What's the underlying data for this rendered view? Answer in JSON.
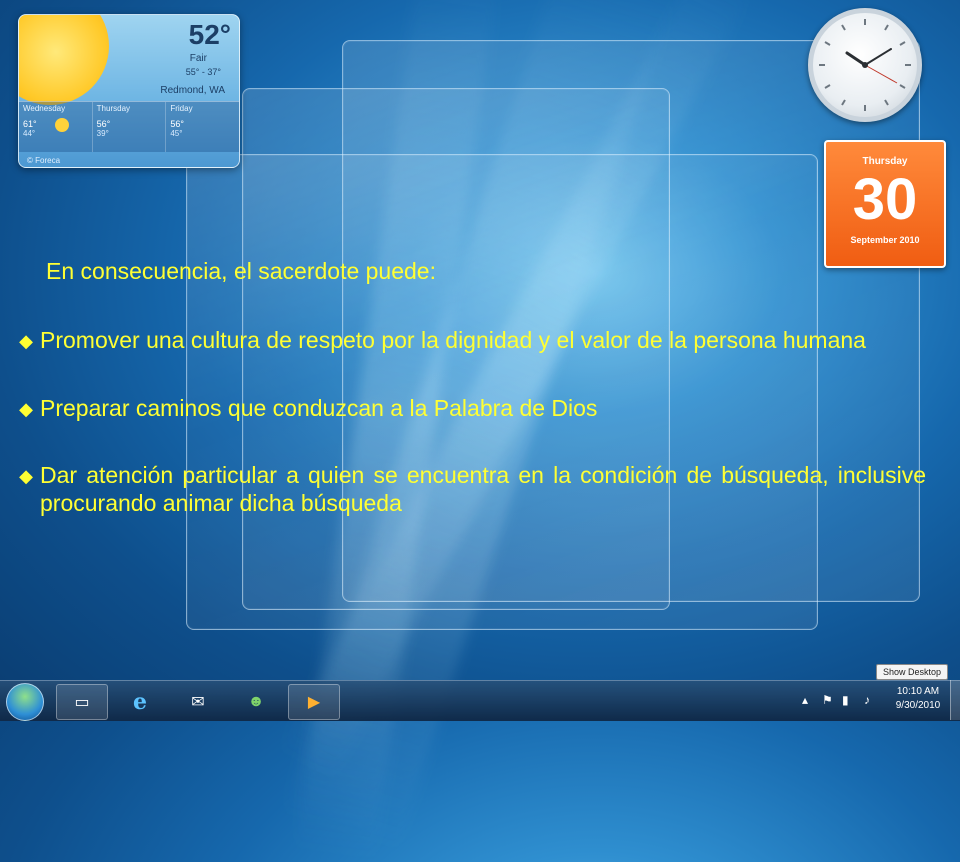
{
  "weather": {
    "temp": "52°",
    "condition": "Fair",
    "range": "55° - 37°",
    "city": "Redmond, WA",
    "days": [
      {
        "name": "Wednesday",
        "hi": "61°",
        "lo": "44°"
      },
      {
        "name": "Thursday",
        "hi": "56°",
        "lo": "39°"
      },
      {
        "name": "Friday",
        "hi": "56°",
        "lo": "45°"
      }
    ],
    "footer": "© Foreca"
  },
  "calendar": {
    "weekday": "Thursday",
    "day": "30",
    "month_year": "September 2010"
  },
  "slide": {
    "lead": "En consecuencia, el sacerdote puede:",
    "bullets": [
      "Promover una cultura de respeto por la dignidad y el valor de la persona humana",
      "Preparar caminos que conduzcan a la Palabra de Dios",
      "Dar atención particular a quien se encuentra en la condición de búsqueda, inclusive procurando animar dicha búsqueda"
    ]
  },
  "taskbar": {
    "time": "10:10 AM",
    "date": "9/30/2010",
    "show_desktop_tooltip": "Show Desktop"
  },
  "colors": {
    "slide_text": "#ffff33",
    "calendar_bg": "#f05d12"
  }
}
